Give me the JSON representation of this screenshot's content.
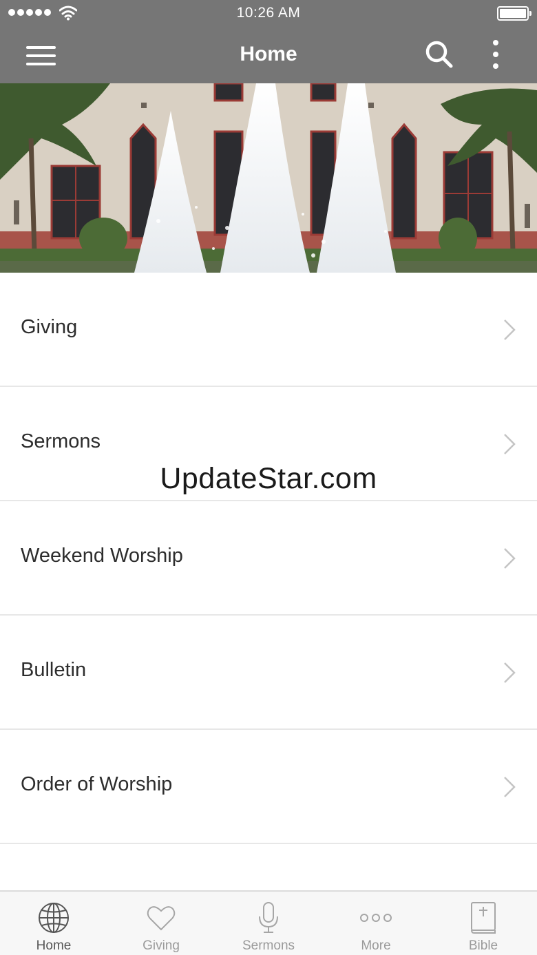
{
  "status_bar": {
    "time": "10:26 AM"
  },
  "nav": {
    "title": "Home"
  },
  "menu": {
    "items": [
      {
        "label": "Giving"
      },
      {
        "label": "Sermons"
      },
      {
        "label": "Weekend Worship"
      },
      {
        "label": "Bulletin"
      },
      {
        "label": "Order of Worship"
      },
      {
        "label": ""
      }
    ]
  },
  "watermark": "UpdateStar.com",
  "tabs": [
    {
      "label": "Home",
      "icon": "globe-icon",
      "active": true
    },
    {
      "label": "Giving",
      "icon": "heart-icon",
      "active": false
    },
    {
      "label": "Sermons",
      "icon": "microphone-icon",
      "active": false
    },
    {
      "label": "More",
      "icon": "ellipsis-icon",
      "active": false
    },
    {
      "label": "Bible",
      "icon": "bible-icon",
      "active": false
    }
  ],
  "colors": {
    "nav_bg": "#767676",
    "tab_bg": "#f7f7f7",
    "divider": "#e7e7e7",
    "text": "#2d2d2d"
  }
}
